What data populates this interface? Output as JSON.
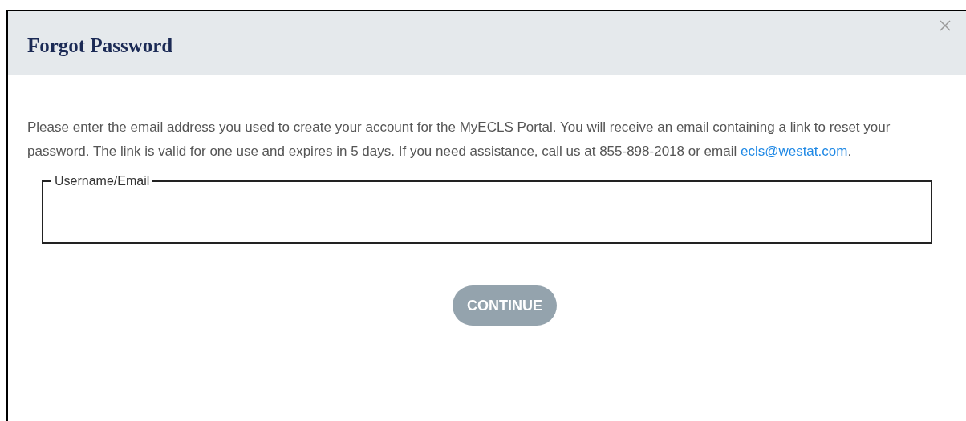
{
  "dialog": {
    "title": "Forgot Password",
    "message": "Please enter the email address you used to create your account for the MyECLS Portal. You will receive an email containing a link to reset your password. The link is valid for one use and expires in 5 days. If you need assistance, call us at 855-898-2018 or email",
    "email_link": "ecls@westat.com",
    "message_end": ".",
    "field": {
      "label": "Username/Email"
    },
    "button": {
      "label": "CONTINUE",
      "disabled": true
    }
  }
}
